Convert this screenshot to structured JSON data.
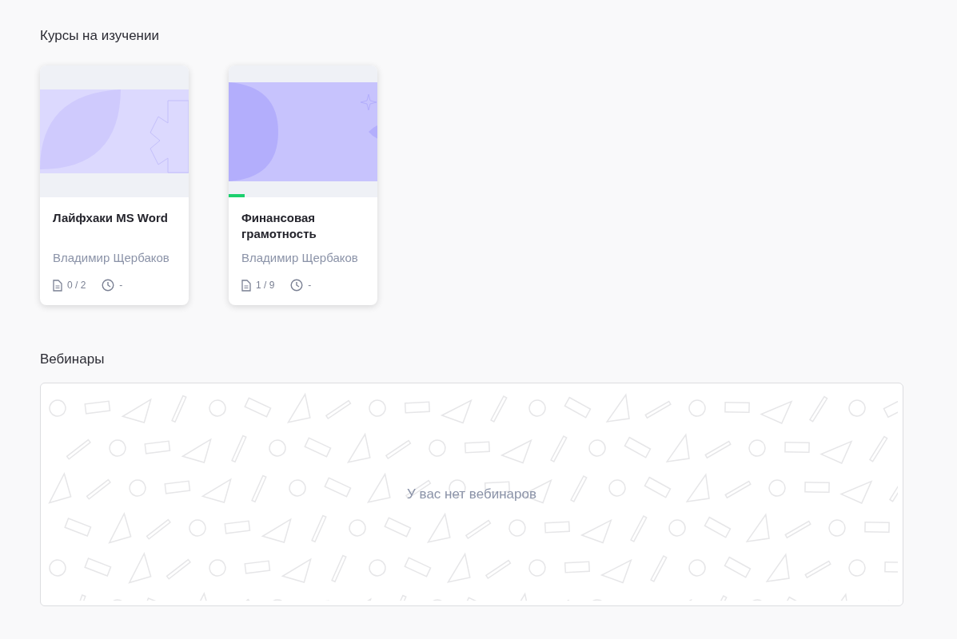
{
  "courses_section": {
    "title": "Курсы на изучении",
    "courses": [
      {
        "kind": "leaf",
        "title": "Лайфхаки MS Word",
        "author": "Владимир Щербаков",
        "lessons": "0 / 2",
        "duration": "-"
      },
      {
        "kind": "eye",
        "title": "Финансовая грамотность",
        "author": "Владимир Щербаков",
        "lessons": "1 / 9",
        "duration": "-",
        "level": 0.11
      }
    ]
  },
  "webinars_section": {
    "title": "Вебинары",
    "empty_message": "У вас нет вебинаров"
  }
}
